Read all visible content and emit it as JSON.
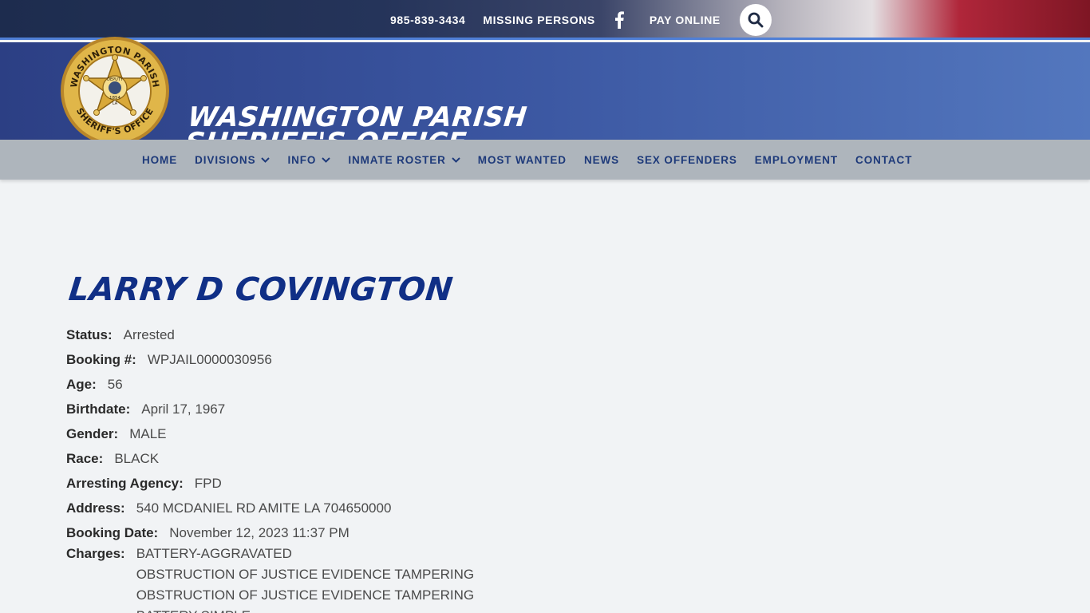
{
  "topbar": {
    "phone": "985-839-3434",
    "missing_persons": "MISSING PERSONS",
    "facebook_icon": "facebook-icon",
    "pay_online": "PAY ONLINE",
    "search_icon": "search-icon"
  },
  "header": {
    "title_line1": "WASHINGTON PARISH",
    "title_line2": "SHERIFF'S OFFICE",
    "badge": {
      "ring_top": "WASHINGTON PARISH",
      "ring_bottom": "SHERIFF'S OFFICE",
      "center_top": "DEPUTY",
      "center_bottom": "1854",
      "center_state": "LA"
    }
  },
  "nav": {
    "items": [
      {
        "label": "HOME",
        "dropdown": false
      },
      {
        "label": "DIVISIONS",
        "dropdown": true
      },
      {
        "label": "INFO",
        "dropdown": true
      },
      {
        "label": "INMATE ROSTER",
        "dropdown": true
      },
      {
        "label": "MOST WANTED",
        "dropdown": false
      },
      {
        "label": "NEWS",
        "dropdown": false
      },
      {
        "label": "SEX OFFENDERS",
        "dropdown": false
      },
      {
        "label": "EMPLOYMENT",
        "dropdown": false
      },
      {
        "label": "CONTACT",
        "dropdown": false
      }
    ]
  },
  "inmate": {
    "name": "LARRY D COVINGTON",
    "fields": [
      {
        "label": "Status:",
        "value": "Arrested"
      },
      {
        "label": "Booking #:",
        "value": "WPJAIL0000030956"
      },
      {
        "label": "Age:",
        "value": "56"
      },
      {
        "label": "Birthdate:",
        "value": "April 17, 1967"
      },
      {
        "label": "Gender:",
        "value": "MALE"
      },
      {
        "label": "Race:",
        "value": "BLACK"
      },
      {
        "label": "Arresting Agency:",
        "value": "FPD"
      },
      {
        "label": "Address:",
        "value": "540 MCDANIEL RD AMITE LA 704650000"
      },
      {
        "label": "Booking Date:",
        "value": "November 12, 2023 11:37 PM"
      }
    ],
    "charges_label": "Charges:",
    "charges": [
      "BATTERY-AGGRAVATED",
      "OBSTRUCTION OF JUSTICE EVIDENCE TAMPERING",
      "OBSTRUCTION OF JUSTICE EVIDENCE TAMPERING",
      "BATTERY-SIMPLE"
    ]
  },
  "colors": {
    "nav_text": "#1e3a7a",
    "name_blue": "#102f86",
    "header_blue": "#3a55a0",
    "nav_bg": "#aeb5bc",
    "page_bg": "#f1f3f5",
    "badge_gold": "#d4a637"
  }
}
